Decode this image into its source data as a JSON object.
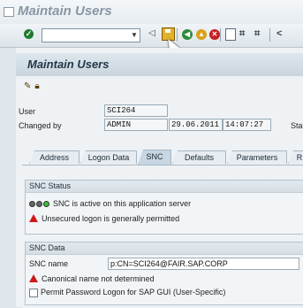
{
  "window": {
    "title": "Maintain Users"
  },
  "toolbar": {
    "command_field_value": "",
    "icons": [
      "enter-icon",
      "back-arrow-icon",
      "save-icon",
      "back-icon",
      "exit-icon",
      "cancel-icon",
      "print-icon",
      "find-icon",
      "find-next-icon"
    ]
  },
  "screen": {
    "title": "Maintain Users"
  },
  "header": {
    "user_label": "User",
    "user_value": "SCI264",
    "changed_by_label": "Changed by",
    "changed_by_value": "ADMIN",
    "changed_date": "29.06.2011",
    "changed_time": "14:07:27",
    "status_label_partial": "Sta"
  },
  "tabs": [
    {
      "label": "Address"
    },
    {
      "label": "Logon Data"
    },
    {
      "label": "SNC"
    },
    {
      "label": "Defaults"
    },
    {
      "label": "Parameters"
    },
    {
      "label": "R"
    }
  ],
  "snc_status": {
    "title": "SNC Status",
    "line1": "SNC is active on this application server",
    "line2": "Unsecured logon is generally permitted"
  },
  "snc_data": {
    "title": "SNC Data",
    "snc_name_label": "SNC name",
    "snc_name_value": "p:CN=SCI264@FAIR.SAP.CORP",
    "canonical_msg": "Canonical name not determined",
    "permit_label": "Permit Password Logon for SAP GUI (User-Specific)",
    "permit_checked": false
  },
  "colors": {
    "warning": "#d01818",
    "active_tab": "#c7d6e2",
    "save": "#e0b32a"
  }
}
